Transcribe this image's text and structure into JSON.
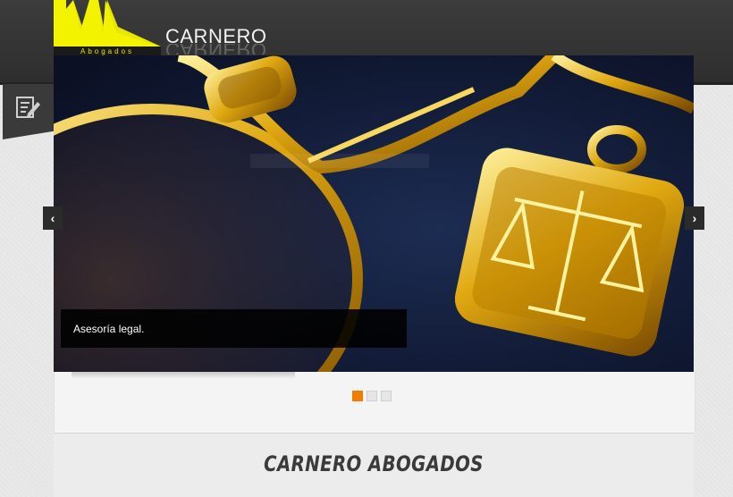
{
  "header": {
    "logo_text": "Abogados",
    "brand": "CARNERO"
  },
  "side_tab": {
    "icon": "edit-note-icon"
  },
  "slider": {
    "caption": "Asesoría legal.",
    "prev_icon": "chevron-left-icon",
    "next_icon": "chevron-right-icon",
    "prev_glyph": "‹",
    "next_glyph": "›",
    "slides_total": 3,
    "active_slide": 1
  },
  "main": {
    "title": "CARNERO ABOGADOS"
  },
  "colors": {
    "accent": "#ef7d00",
    "logo_yellow": "#e6e600",
    "header_bg": "#353535"
  }
}
